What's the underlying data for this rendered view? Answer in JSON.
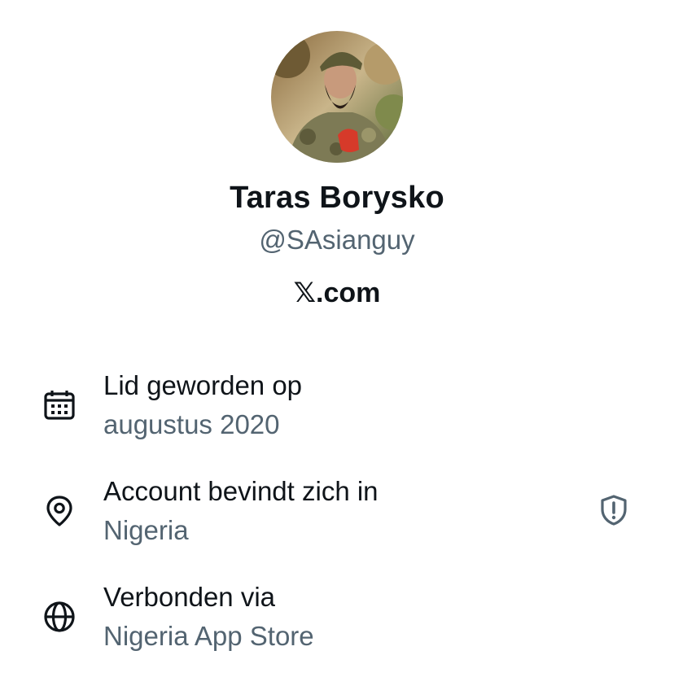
{
  "profile": {
    "name": "Taras Borysko",
    "handle": "@SAsianguy",
    "domain": "𝕏.com",
    "avatar": "profile-photo"
  },
  "details": [
    {
      "label": "Lid geworden op",
      "value": "augustus 2020",
      "icon": "calendar-icon"
    },
    {
      "label": "Account bevindt zich in",
      "value": "Nigeria",
      "icon": "location-pin-icon",
      "extra_icon": "shield-alert-icon"
    },
    {
      "label": "Verbonden via",
      "value": "Nigeria App Store",
      "icon": "globe-icon"
    }
  ],
  "colors": {
    "primary_text": "#0f1419",
    "secondary_text": "#536471"
  }
}
